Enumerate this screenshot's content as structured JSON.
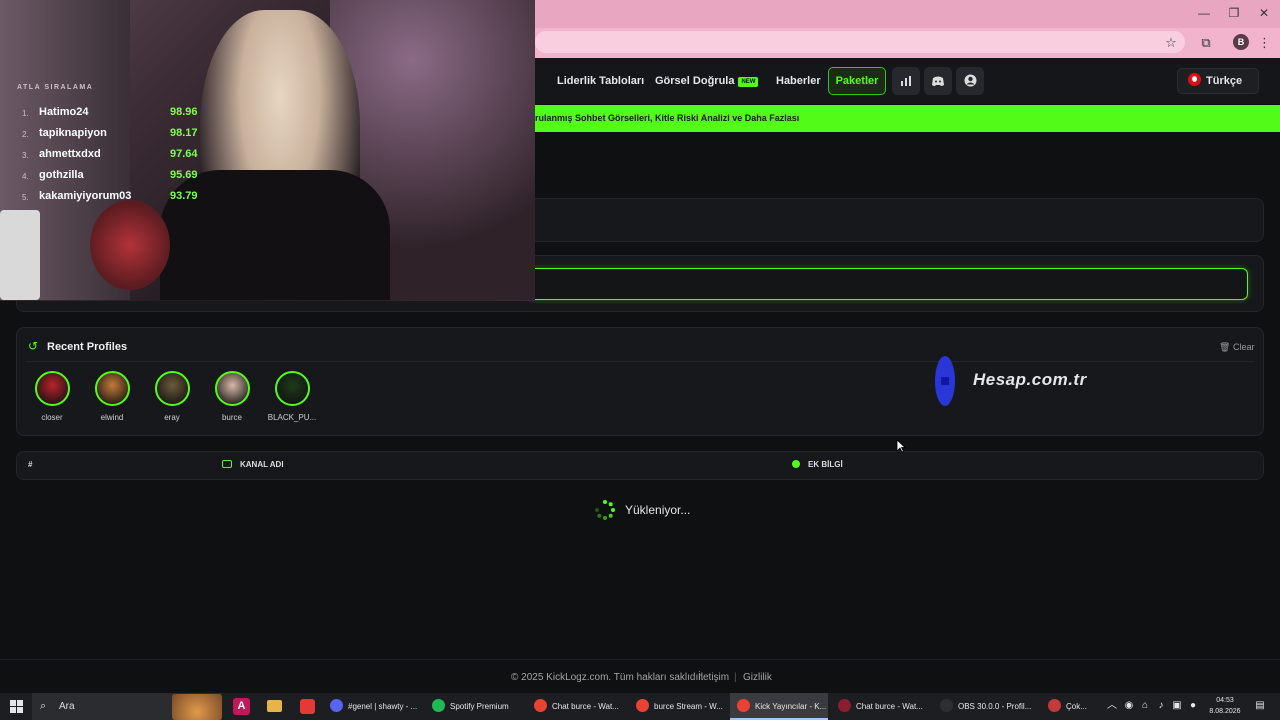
{
  "browser": {
    "window_controls": [
      "—",
      "❐",
      "✕"
    ],
    "profile_initial": "B"
  },
  "nav": {
    "leaderboard": "Liderlik Tabloları",
    "visual_verify": "Görsel Doğrula",
    "new_badge": "NEW",
    "news": "Haberler",
    "packages": "Paketler",
    "language": "Türkçe"
  },
  "banner": {
    "text": "rulanmış Sohbet Görselleri, Kitle Riski Analizi ve Daha Fazlası"
  },
  "recent": {
    "title": "Recent Profiles",
    "clear": "Clear",
    "profiles": [
      {
        "name": "closer",
        "color": "#b8232c"
      },
      {
        "name": "elwind",
        "color": "#c47b3a"
      },
      {
        "name": "eray",
        "color": "#6b5a3b"
      },
      {
        "name": "burce",
        "color": "#d9b9a8"
      },
      {
        "name": "BLACK_PU...",
        "color": "#1f3a1c"
      }
    ]
  },
  "ad": {
    "text": "Hesap.com.tr"
  },
  "table": {
    "col_hash": "#",
    "col_channel": "KANAL ADI",
    "col_extra": "EK BİLGİ",
    "loading": "Yükleniyor..."
  },
  "footer": {
    "copyright": "© 2025 KickLogz.com. Tüm hakları saklıdır.",
    "contact": "İletişim",
    "privacy": "Gizlilik",
    "separator": "|"
  },
  "webcam": {
    "ranking_title": "ATLA SIRALAMA",
    "rows": [
      {
        "rank": "1.",
        "name": "Hatimo24",
        "score": "98.96"
      },
      {
        "rank": "2.",
        "name": "tapiknapiyon",
        "score": "98.17"
      },
      {
        "rank": "3.",
        "name": "ahmettxdxd",
        "score": "97.64"
      },
      {
        "rank": "4.",
        "name": "gothzilla",
        "score": "95.69"
      },
      {
        "rank": "5.",
        "name": "kakamiyiyorum03",
        "score": "93.79"
      }
    ]
  },
  "taskbar": {
    "search": "Ara",
    "items": [
      {
        "label": "#genel | shawty - ...",
        "color": "#5865f2"
      },
      {
        "label": "Spotify Premium",
        "color": "#1db954"
      },
      {
        "label": "Chat burce - Wat...",
        "color": "#e94235"
      },
      {
        "label": "burce Stream - W...",
        "color": "#e94235"
      },
      {
        "label": "Kick Yayıncılar - K...",
        "color": "#e94235"
      },
      {
        "label": "Chat burce - Wat...",
        "color": "#8b1e2e"
      },
      {
        "label": "OBS 30.0.0 - Profil...",
        "color": "#302e31"
      },
      {
        "label": "Çok...",
        "color": "#c23a3a"
      }
    ],
    "time": "04:53",
    "date": "8.08.2026"
  }
}
